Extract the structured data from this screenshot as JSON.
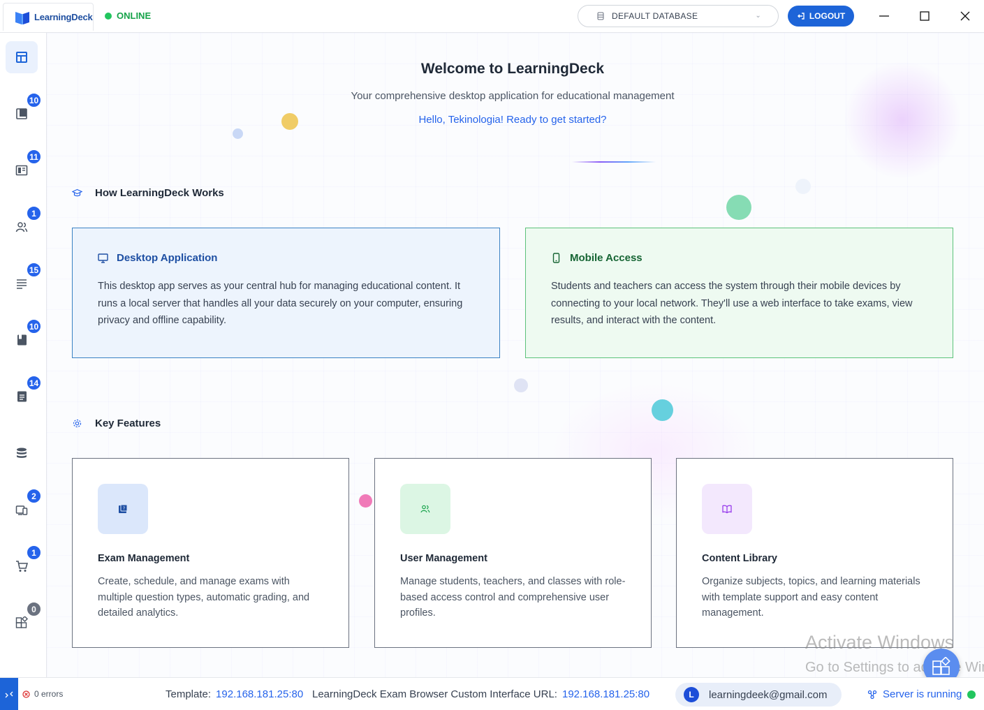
{
  "app": {
    "name": "LearningDeck",
    "status": "ONLINE"
  },
  "header": {
    "database": "DEFAULT DATABASE",
    "logout_label": "LOGOUT"
  },
  "sidebar": {
    "items": [
      {
        "icon": "dashboard-icon",
        "badge": ""
      },
      {
        "icon": "exam-book-icon",
        "badge": "10"
      },
      {
        "icon": "reader-icon",
        "badge": "11"
      },
      {
        "icon": "users-icon",
        "badge": "1"
      },
      {
        "icon": "list-icon",
        "badge": "15"
      },
      {
        "icon": "book-icon",
        "badge": "10"
      },
      {
        "icon": "document-icon",
        "badge": "14"
      },
      {
        "icon": "database-icon",
        "badge": ""
      },
      {
        "icon": "devices-icon",
        "badge": "2"
      },
      {
        "icon": "cart-icon",
        "badge": "1"
      },
      {
        "icon": "plugins-icon",
        "badge": "0"
      }
    ]
  },
  "hero": {
    "title": "Welcome to LearningDeck",
    "subtitle": "Your comprehensive desktop application for educational management",
    "greeting": "Hello, Tekinologia! Ready to get started?"
  },
  "how_it_works": {
    "heading": "How LearningDeck Works",
    "desktop": {
      "title": "Desktop Application",
      "text": "This desktop app serves as your central hub for managing educational content. It runs a local server that handles all your data securely on your computer, ensuring privacy and offline capability."
    },
    "mobile": {
      "title": "Mobile Access",
      "text": "Students and teachers can access the system through their mobile devices by connecting to your local network. They'll use a web interface to take exams, view results, and interact with the content."
    }
  },
  "features": {
    "heading": "Key Features",
    "items": [
      {
        "title": "Exam Management",
        "text": "Create, schedule, and manage exams with multiple question types, automatic grading, and detailed analytics.",
        "color": "#dbe7fb"
      },
      {
        "title": "User Management",
        "text": "Manage students, teachers, and classes with role-based access control and comprehensive user profiles.",
        "color": "#dcf6e4"
      },
      {
        "title": "Content Library",
        "text": "Organize subjects, topics, and learning materials with template support and easy content management.",
        "color": "#f3e8fd"
      }
    ]
  },
  "watermark": {
    "line1": "Activate Windows",
    "line2": "Go to Settings to activate Windows."
  },
  "statusbar": {
    "errors": "0 errors",
    "template_label": "Template:",
    "template_value": "192.168.181.25:80",
    "url_label": "LearningDeck Exam Browser Custom Interface URL:",
    "url_value": "192.168.181.25:80",
    "avatar_letter": "L",
    "email": "learningdeek@gmail.com",
    "server_status": "Server is running"
  },
  "colors": {
    "accent": "#1d64d8",
    "online": "#22c55e",
    "link": "#2563eb"
  }
}
